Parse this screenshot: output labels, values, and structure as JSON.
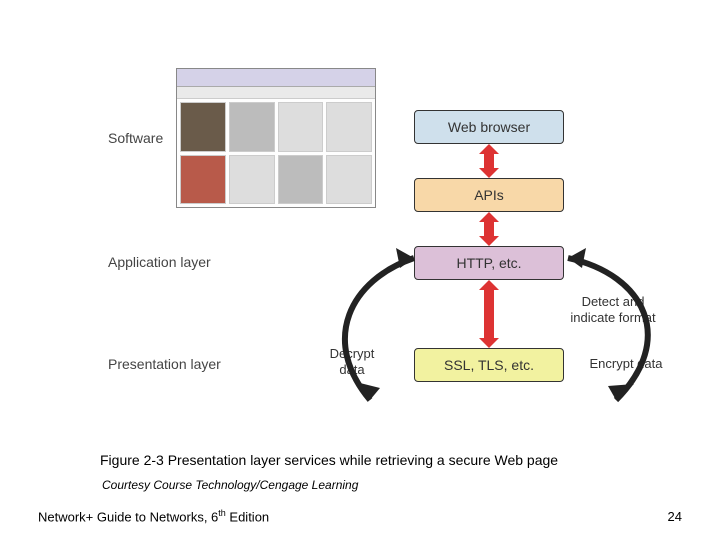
{
  "labels": {
    "software": "Software",
    "app_layer": "Application layer",
    "pres_layer": "Presentation layer"
  },
  "boxes": {
    "web_browser": "Web browser",
    "apis": "APIs",
    "http": "HTTP, etc.",
    "ssl": "SSL, TLS, etc."
  },
  "annotations": {
    "detect": "Detect and indicate format",
    "decrypt": "Decrypt data",
    "encrypt": "Encrypt data"
  },
  "caption": "Figure 2-3 Presentation layer services while retrieving a secure Web page",
  "courtesy": "Courtesy Course Technology/Cengage Learning",
  "footer": {
    "book": "Network+ Guide to Networks, 6",
    "edition_sup": "th",
    "edition_tail": " Edition",
    "page": "24"
  }
}
